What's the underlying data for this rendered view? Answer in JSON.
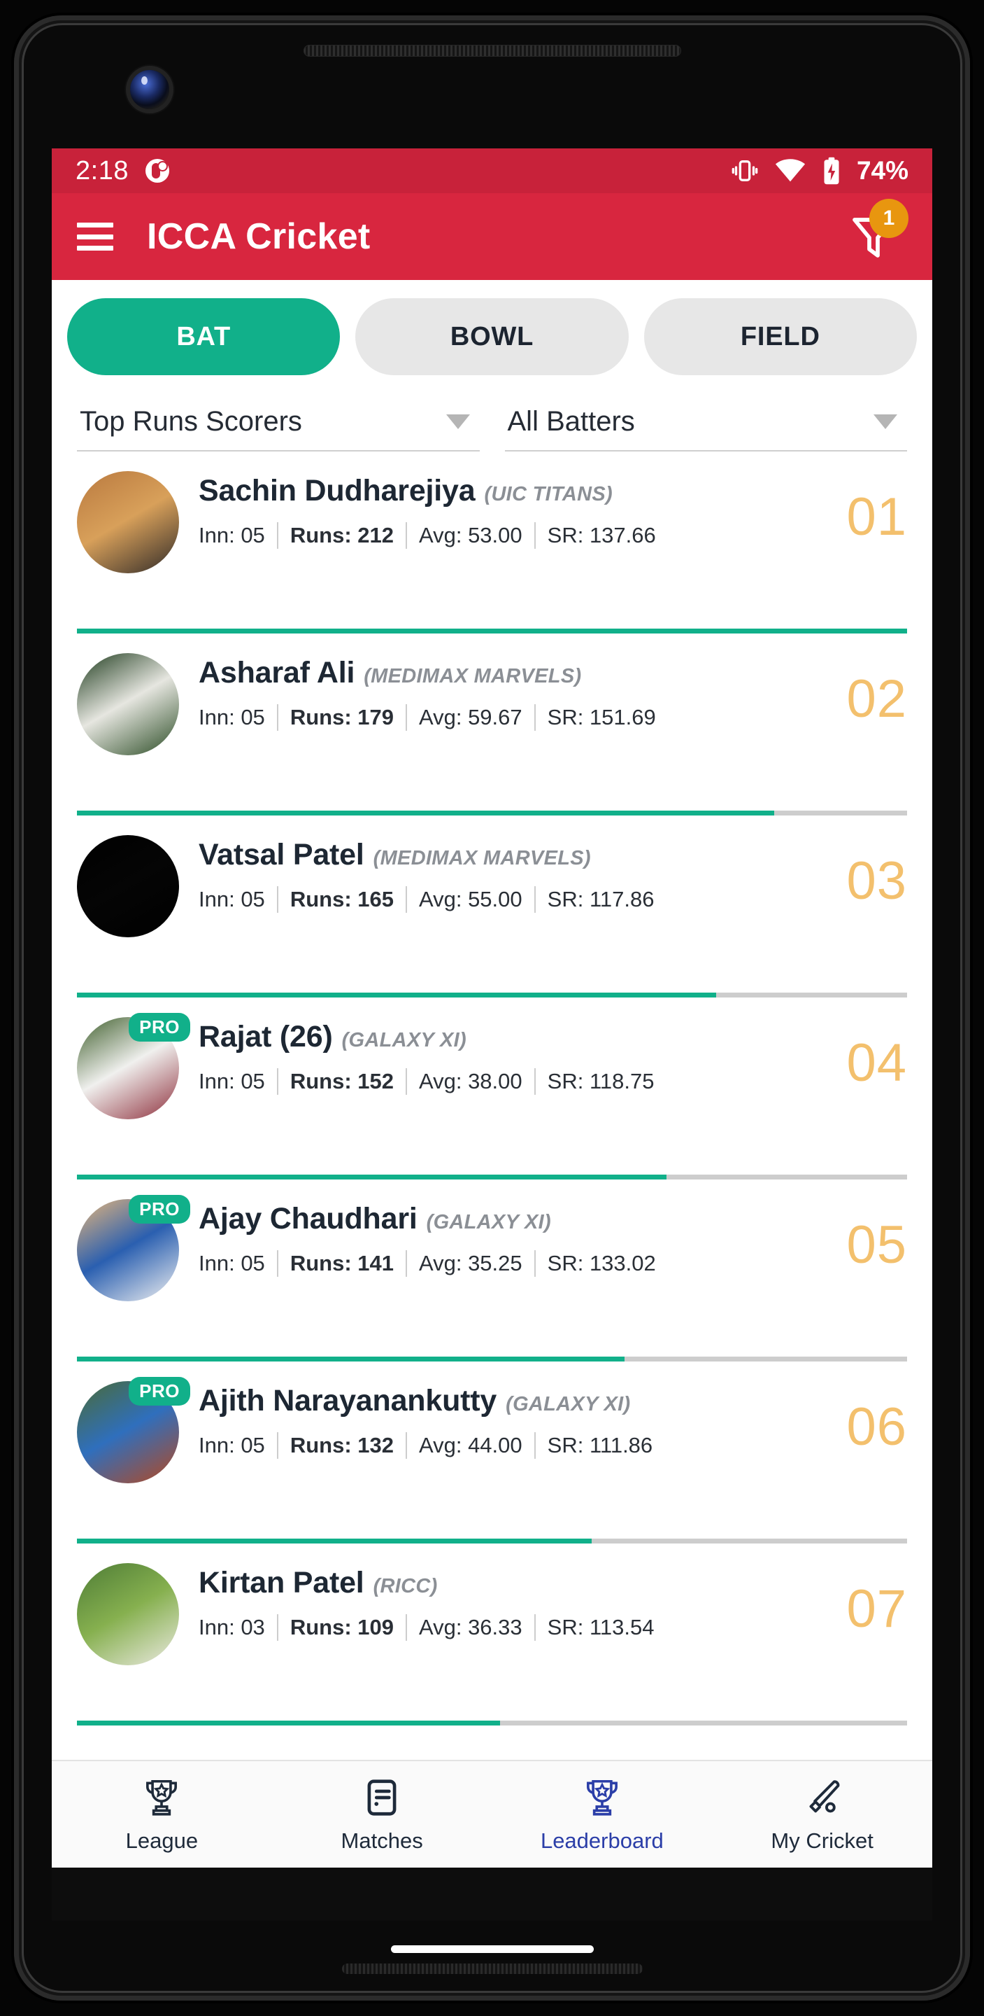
{
  "status_bar": {
    "time": "2:18",
    "notification_icon": "app-notification-icon",
    "vibrate_icon": "vibrate-icon",
    "wifi_icon": "wifi-icon",
    "battery_icon": "battery-charging-icon",
    "battery_percent": "74%"
  },
  "app_bar": {
    "menu_icon": "hamburger-menu-icon",
    "title": "ICCA Cricket",
    "filter_icon": "filter-icon",
    "filter_badge_count": "1"
  },
  "tabs": [
    {
      "label": "BAT",
      "active": true
    },
    {
      "label": "BOWL",
      "active": false
    },
    {
      "label": "FIELD",
      "active": false
    }
  ],
  "filters": [
    {
      "name": "stat-type-dropdown",
      "value": "Top Runs Scorers"
    },
    {
      "name": "batter-filter-dropdown",
      "value": "All Batters"
    }
  ],
  "players": [
    {
      "rank": "01",
      "name": "Sachin Dudharejiya",
      "team": "(UIC TITANS)",
      "inn_label": "Inn: 05",
      "runs_label": "Runs: 212",
      "avg_label": "Avg: 53.00",
      "sr_label": "SR: 137.66",
      "pro": false,
      "progress_percent": 100,
      "avatar_colors": [
        "#b9793f",
        "#d8a05a",
        "#2f2a28"
      ]
    },
    {
      "rank": "02",
      "name": "Asharaf Ali",
      "team": "(MEDIMAX MARVELS)",
      "inn_label": "Inn: 05",
      "runs_label": "Runs: 179",
      "avg_label": "Avg: 59.67",
      "sr_label": "SR: 151.69",
      "pro": false,
      "progress_percent": 84,
      "avatar_colors": [
        "#1d3a1c",
        "#e6e6e0",
        "#2a4b24"
      ]
    },
    {
      "rank": "03",
      "name": "Vatsal Patel",
      "team": "(MEDIMAX MARVELS)",
      "inn_label": "Inn: 05",
      "runs_label": "Runs: 165",
      "avg_label": "Avg: 55.00",
      "sr_label": "SR: 117.86",
      "pro": false,
      "progress_percent": 77,
      "avatar_colors": [
        "#000000",
        "#050505",
        "#000000"
      ]
    },
    {
      "rank": "04",
      "name": "Rajat (26)",
      "team": "(GALAXY XI)",
      "inn_label": "Inn: 05",
      "runs_label": "Runs: 152",
      "avg_label": "Avg: 38.00",
      "sr_label": "SR: 118.75",
      "pro": true,
      "progress_percent": 71,
      "avatar_colors": [
        "#3d5d2a",
        "#f0f0ee",
        "#8e2f3c"
      ]
    },
    {
      "rank": "05",
      "name": "Ajay Chaudhari",
      "team": "(GALAXY XI)",
      "inn_label": "Inn: 05",
      "runs_label": "Runs: 141",
      "avg_label": "Avg: 35.25",
      "sr_label": "SR: 133.02",
      "pro": true,
      "progress_percent": 66,
      "avatar_colors": [
        "#e8b77a",
        "#2a5fb0",
        "#f2f2f2"
      ]
    },
    {
      "rank": "06",
      "name": "Ajith Narayanankutty",
      "team": "(GALAXY XI)",
      "inn_label": "Inn: 05",
      "runs_label": "Runs: 132",
      "avg_label": "Avg: 44.00",
      "sr_label": "SR: 111.86",
      "pro": true,
      "progress_percent": 62,
      "avatar_colors": [
        "#4a6b35",
        "#2f6fbd",
        "#b5481f"
      ]
    },
    {
      "rank": "07",
      "name": "Kirtan Patel",
      "team": "(RICC)",
      "inn_label": "Inn: 03",
      "runs_label": "Runs: 109",
      "avg_label": "Avg: 36.33",
      "sr_label": "SR: 113.54",
      "pro": false,
      "progress_percent": 51,
      "avatar_colors": [
        "#4e7c36",
        "#86b04f",
        "#eceae2"
      ]
    }
  ],
  "pro_badge_label": "PRO",
  "bottom_nav": [
    {
      "label": "League",
      "icon": "trophy-icon",
      "active": false
    },
    {
      "label": "Matches",
      "icon": "matches-list-icon",
      "active": false
    },
    {
      "label": "Leaderboard",
      "icon": "trophy-icon",
      "active": true
    },
    {
      "label": "My Cricket",
      "icon": "cricket-bat-icon",
      "active": false
    }
  ],
  "colors": {
    "status_bar": "#c8223a",
    "app_bar": "#d8263f",
    "accent_teal": "#11b08a",
    "rank_gold": "#f3c06d",
    "badge_orange": "#e8960f",
    "nav_active": "#2b3ea8"
  }
}
